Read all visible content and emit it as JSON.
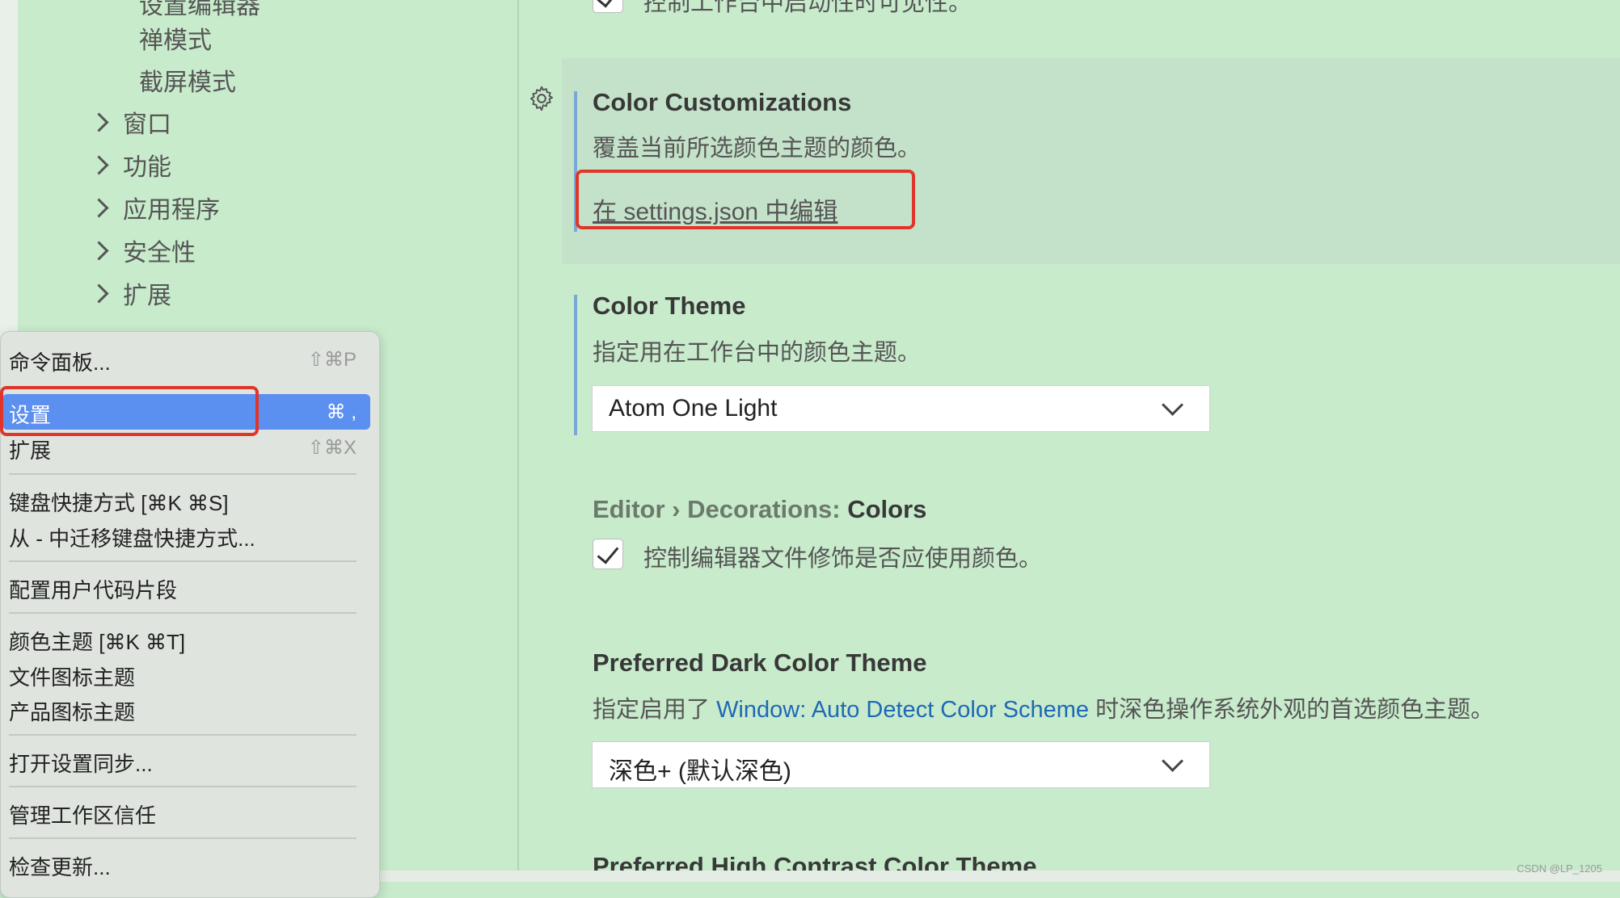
{
  "tree": {
    "items": [
      "设置编辑器",
      "禅模式",
      "截屏模式"
    ],
    "groups": [
      "窗口",
      "功能",
      "应用程序",
      "安全性",
      "扩展"
    ]
  },
  "menu": {
    "command_palette": {
      "label": "命令面板...",
      "shortcut": "⇧⌘P"
    },
    "settings": {
      "label": "设置",
      "shortcut": "⌘ ,"
    },
    "extensions": {
      "label": "扩展",
      "shortcut": "⇧⌘X"
    },
    "keyboard_shortcuts": "键盘快捷方式 [⌘K ⌘S]",
    "migrate_shortcuts": "从 - 中迁移键盘快捷方式...",
    "user_snippets": "配置用户代码片段",
    "color_theme": "颜色主题 [⌘K ⌘T]",
    "file_icon_theme": "文件图标主题",
    "product_icon_theme": "产品图标主题",
    "settings_sync": "打开设置同步...",
    "workspace_trust": "管理工作区信任",
    "check_updates": "检查更新..."
  },
  "settings": {
    "top_desc": "控制工作台中启动性时可见性。",
    "color_customizations": {
      "title": "Color Customizations",
      "desc": "覆盖当前所选颜色主题的颜色。",
      "edit_link": "在 settings.json 中编辑"
    },
    "color_theme": {
      "title": "Color Theme",
      "desc": "指定用在工作台中的颜色主题。",
      "value": "Atom One Light"
    },
    "decorations_colors": {
      "category": "Editor › Decorations: ",
      "title": "Colors",
      "desc": "控制编辑器文件修饰是否应使用颜色。",
      "checked": true
    },
    "preferred_dark": {
      "title": "Preferred Dark Color Theme",
      "desc_prefix": "指定启用了 ",
      "desc_link": "Window: Auto Detect Color Scheme",
      "desc_suffix": " 时深色操作系统外观的首选颜色主题。",
      "value": "深色+ (默认深色)"
    },
    "preferred_hc": {
      "title": "Preferred High Contrast Color Theme"
    }
  },
  "watermark": "CSDN @LP_1205",
  "colors": {
    "accent": "#5b8ff0",
    "highlight_box": "#e0352a",
    "background": "#c8ebcc",
    "link": "#1f68b6"
  }
}
